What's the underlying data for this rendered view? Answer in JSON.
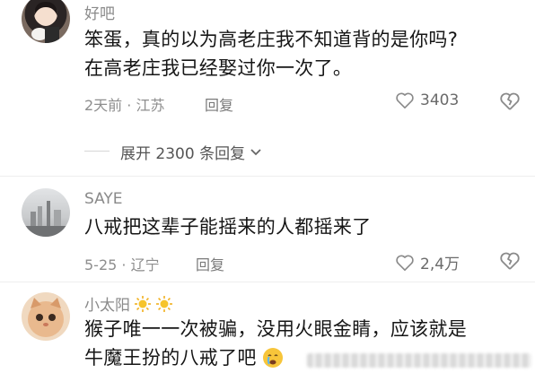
{
  "comments": [
    {
      "username": "好吧",
      "lines": [
        "笨蛋，真的以为高老庄我不知道背的是你吗?",
        "在高老庄我已经娶过你一次了。"
      ],
      "meta": "2天前 · 江苏",
      "reply_label": "回复",
      "likes": "3403",
      "expand_label": "展开 2300 条回复"
    },
    {
      "username": "SAYE",
      "lines": [
        "八戒把这辈子能摇来的人都摇来了"
      ],
      "meta": "5-25 · 辽宁",
      "reply_label": "回复",
      "likes": "2,4万"
    },
    {
      "username": "小太阳",
      "lines": [
        "猴子唯一一次被骗，没用火眼金睛，应该就是",
        "牛魔王扮的八戒了吧"
      ]
    }
  ],
  "icons": {
    "like": "heart-outline-icon",
    "dislike": "broken-heart-icon",
    "expand": "chevron-down-icon",
    "username_badge": "sun-icon",
    "emoji": "crying-face-icon"
  },
  "colors": {
    "text": "#161616",
    "meta": "#8e8e8e",
    "sun": "#f2b01e"
  }
}
